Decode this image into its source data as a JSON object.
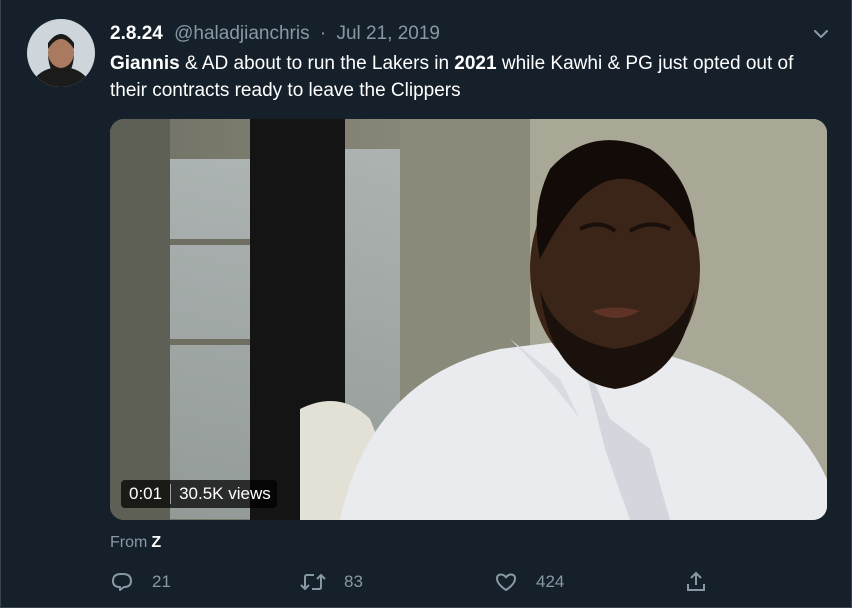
{
  "tweet": {
    "display_name": "2.8.24",
    "handle": "@haladjianchris",
    "separator": "·",
    "date": "Jul 21, 2019",
    "text": {
      "p1_bold": "Giannis",
      "p2": " & AD about to run the Lakers in ",
      "p3_bold": "2021",
      "p4": " while Kawhi & PG just opted out of their contracts ready to leave the Clippers"
    },
    "video": {
      "time": "0:01",
      "views": "30.5K views"
    },
    "source": {
      "prefix": "From",
      "name": "Z"
    },
    "actions": {
      "replies": "21",
      "retweets": "83",
      "likes": "424"
    }
  },
  "icons": {
    "more": "chevron-down-icon",
    "reply": "reply-icon",
    "retweet": "retweet-icon",
    "like": "heart-icon",
    "share": "share-icon"
  },
  "colors": {
    "background": "#15202b",
    "secondary_text": "#8899a6",
    "border": "#38444d"
  }
}
